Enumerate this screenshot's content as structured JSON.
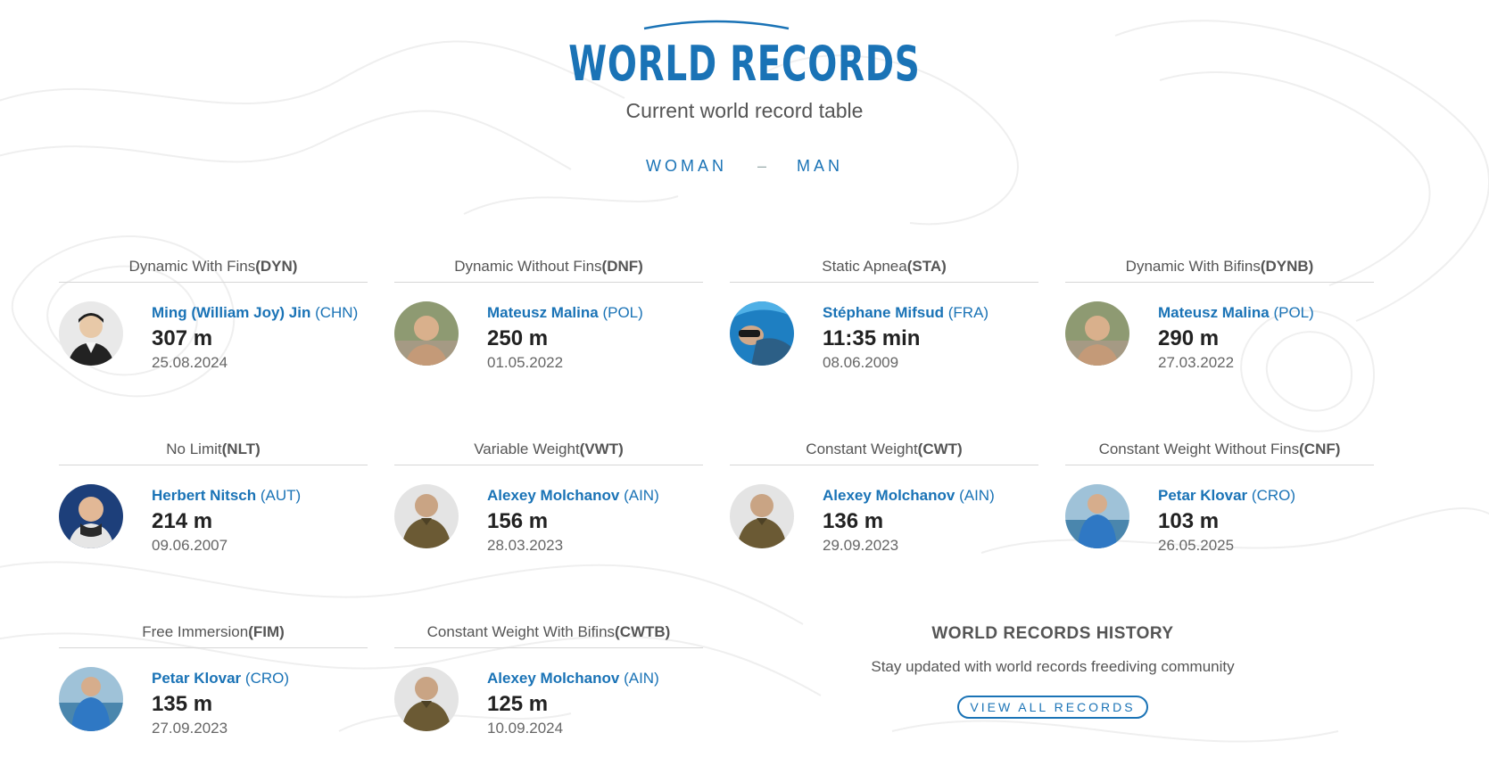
{
  "header": {
    "title": "WORLD RECORDS",
    "subtitle": "Current world record table"
  },
  "gender_tabs": {
    "woman": "WOMAN",
    "separator": "–",
    "man": "MAN"
  },
  "records": [
    {
      "discipline": "Dynamic With Fins",
      "code": "(DYN)",
      "athlete": "Ming (William Joy) Jin",
      "country": "(CHN)",
      "value": "307 m",
      "date": "25.08.2024",
      "avatar": "portrait-dark-suit"
    },
    {
      "discipline": "Dynamic Without Fins",
      "code": "(DNF)",
      "athlete": "Mateusz Malina",
      "country": "(POL)",
      "value": "250 m",
      "date": "01.05.2022",
      "avatar": "portrait-bald-outdoor"
    },
    {
      "discipline": "Static Apnea",
      "code": "(STA)",
      "athlete": "Stéphane Mifsud",
      "country": "(FRA)",
      "value": "11:35 min",
      "date": "08.06.2009",
      "avatar": "portrait-underwater"
    },
    {
      "discipline": "Dynamic With Bifins",
      "code": "(DYNB)",
      "athlete": "Mateusz Malina",
      "country": "(POL)",
      "value": "290 m",
      "date": "27.03.2022",
      "avatar": "portrait-bald-outdoor"
    },
    {
      "discipline": "No Limit",
      "code": "(NLT)",
      "athlete": "Herbert Nitsch",
      "country": "(AUT)",
      "value": "214 m",
      "date": "09.06.2007",
      "avatar": "portrait-wetsuit-blue"
    },
    {
      "discipline": "Variable Weight",
      "code": "(VWT)",
      "athlete": "Alexey Molchanov",
      "country": "(AIN)",
      "value": "156 m",
      "date": "28.03.2023",
      "avatar": "portrait-olive-top"
    },
    {
      "discipline": "Constant Weight",
      "code": "(CWT)",
      "athlete": "Alexey Molchanov",
      "country": "(AIN)",
      "value": "136 m",
      "date": "29.09.2023",
      "avatar": "portrait-olive-top"
    },
    {
      "discipline": "Constant Weight Without Fins",
      "code": "(CNF)",
      "athlete": "Petar Klovar",
      "country": "(CRO)",
      "value": "103 m",
      "date": "26.05.2025",
      "avatar": "portrait-blue-wetsuit"
    },
    {
      "discipline": "Free Immersion",
      "code": "(FIM)",
      "athlete": "Petar Klovar",
      "country": "(CRO)",
      "value": "135 m",
      "date": "27.09.2023",
      "avatar": "portrait-blue-wetsuit"
    },
    {
      "discipline": "Constant Weight With Bifins",
      "code": "(CWTB)",
      "athlete": "Alexey Molchanov",
      "country": "(AIN)",
      "value": "125 m",
      "date": "10.09.2024",
      "avatar": "portrait-olive-top"
    }
  ],
  "history": {
    "title": "WORLD RECORDS HISTORY",
    "subtitle": "Stay updated with world records freediving community",
    "button_label": "VIEW ALL RECORDS"
  },
  "colors": {
    "accent": "#1a73b6",
    "text": "#555555",
    "divider": "#d6d6d6"
  }
}
